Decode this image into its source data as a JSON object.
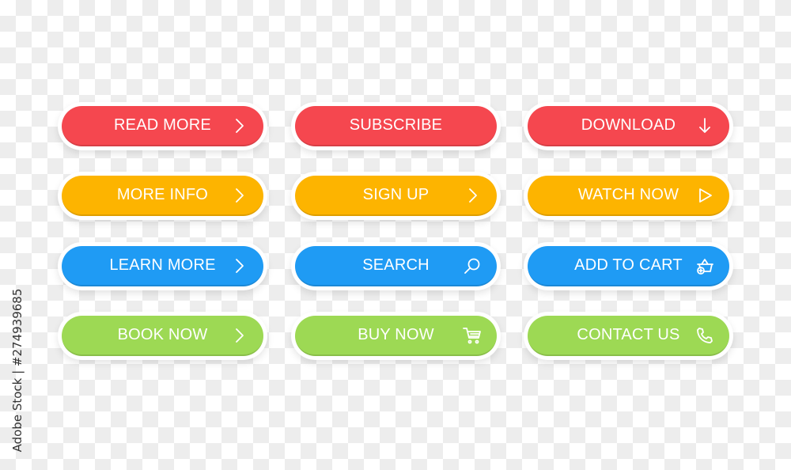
{
  "colors": {
    "red": "#f5474f",
    "yellow": "#fdb400",
    "blue": "#1f9bf4",
    "green": "#9dd954"
  },
  "buttons": [
    {
      "label": "READ MORE",
      "color": "red",
      "icon": "chevron-right-icon"
    },
    {
      "label": "SUBSCRIBE",
      "color": "red",
      "icon": ""
    },
    {
      "label": "DOWNLOAD",
      "color": "red",
      "icon": "arrow-down-icon"
    },
    {
      "label": "MORE INFO",
      "color": "yellow",
      "icon": "chevron-right-icon"
    },
    {
      "label": "SIGN UP",
      "color": "yellow",
      "icon": "chevron-right-icon"
    },
    {
      "label": "WATCH NOW",
      "color": "yellow",
      "icon": "play-icon"
    },
    {
      "label": "LEARN MORE",
      "color": "blue",
      "icon": "chevron-right-icon"
    },
    {
      "label": "SEARCH",
      "color": "blue",
      "icon": "search-icon"
    },
    {
      "label": "ADD TO CART",
      "color": "blue",
      "icon": "basket-add-icon"
    },
    {
      "label": "BOOK NOW",
      "color": "green",
      "icon": "chevron-right-icon"
    },
    {
      "label": "BUY NOW",
      "color": "green",
      "icon": "cart-icon"
    },
    {
      "label": "CONTACT US",
      "color": "green",
      "icon": "phone-icon"
    }
  ],
  "watermark": "Adobe Stock | #274939685"
}
